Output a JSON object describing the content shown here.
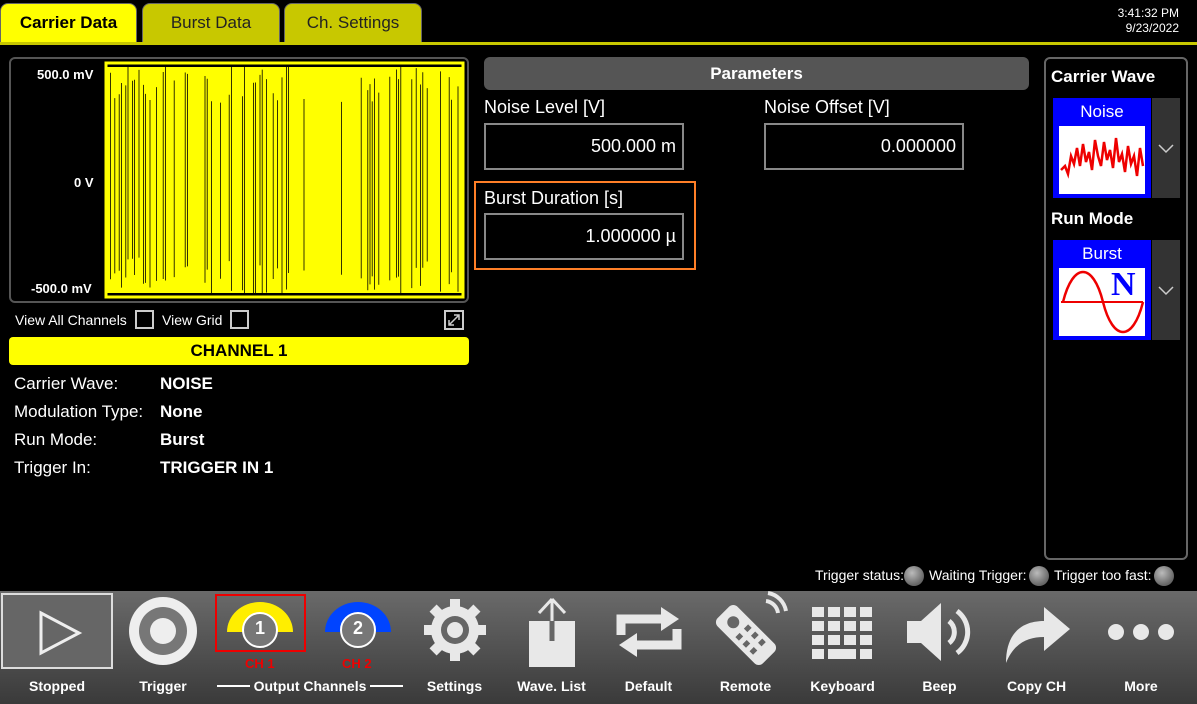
{
  "tabs": [
    {
      "label": "Carrier Data",
      "active": true
    },
    {
      "label": "Burst Data",
      "active": false
    },
    {
      "label": "Ch. Settings",
      "active": false
    }
  ],
  "clock": {
    "time": "3:41:32 PM",
    "date": "9/23/2022"
  },
  "scope": {
    "y_top": "500.0 mV",
    "y_mid": "0 V",
    "y_bottom": "-500.0 mV",
    "trace_color": "#ffff00",
    "view_all_channels": "View All Channels",
    "view_grid": "View Grid"
  },
  "channel": {
    "title": "CHANNEL 1",
    "rows": [
      {
        "key": "Carrier Wave:",
        "value": "NOISE"
      },
      {
        "key": "Modulation Type:",
        "value": "None"
      },
      {
        "key": "Run Mode:",
        "value": "Burst"
      },
      {
        "key": "Trigger In:",
        "value": "TRIGGER IN 1"
      }
    ]
  },
  "parameters": {
    "title": "Parameters",
    "noise_level_label": "Noise Level [V]",
    "noise_level_value": "500.000 m",
    "noise_offset_label": "Noise Offset [V]",
    "noise_offset_value": "0.000000",
    "burst_duration_label": "Burst Duration [s]",
    "burst_duration_value": "1.000000 µ"
  },
  "right_panel": {
    "carrier_wave_title": "Carrier Wave",
    "carrier_wave_option": "Noise",
    "run_mode_title": "Run Mode",
    "run_mode_option": "Burst",
    "run_mode_symbol": "N"
  },
  "trigger_status": {
    "status_label": "Trigger status:",
    "waiting_label": "Waiting Trigger:",
    "too_fast_label": "Trigger too fast:"
  },
  "toolbar": {
    "stopped": "Stopped",
    "trigger": "Trigger",
    "ch1_number": "1",
    "ch1_label": "CH 1",
    "ch2_number": "2",
    "ch2_label": "CH 2",
    "output_channels": "Output Channels",
    "settings": "Settings",
    "wave_list": "Wave. List",
    "default": "Default",
    "remote": "Remote",
    "keyboard": "Keyboard",
    "beep": "Beep",
    "copy_ch": "Copy CH",
    "more": "More"
  },
  "colors": {
    "accent_yellow": "#ffff00",
    "channel2_blue": "#0044ff",
    "highlight_orange": "#ff7f27"
  }
}
